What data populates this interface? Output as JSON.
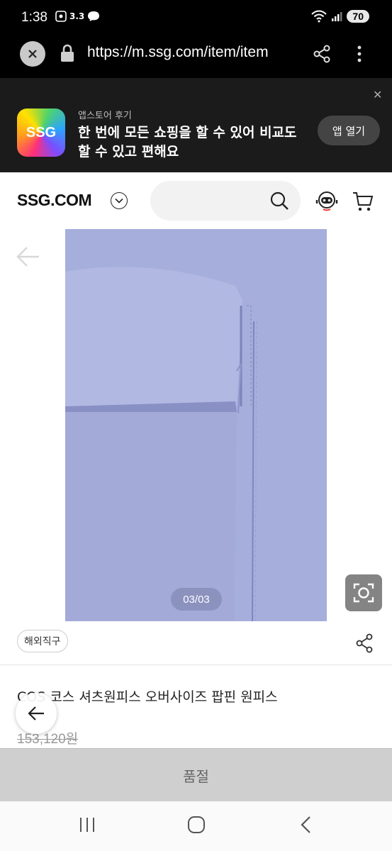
{
  "status_bar": {
    "time": "1:38",
    "speed": "3.3",
    "battery": "70"
  },
  "browser": {
    "url": "https://m.ssg.com/item/item"
  },
  "app_banner": {
    "logo_text": "SSG",
    "subtitle": "앱스토어 후기",
    "title": "한 번에 모든 쇼핑을 할 수 있어 비교도 할 수 있고 편해요",
    "open_button": "앱 열기"
  },
  "header": {
    "logo": "SSG.COM"
  },
  "product": {
    "image_counter": "03/03",
    "badge": "해외직구",
    "title": "COS 코스 셔츠원피스 오버사이즈 팝핀 원피스",
    "original_price": "153,120원",
    "status_button": "품절"
  },
  "colors": {
    "product_fabric": "#a6aedc",
    "banner_bg": "#1b1b1b",
    "soldout_bg": "#cfcfcf"
  }
}
